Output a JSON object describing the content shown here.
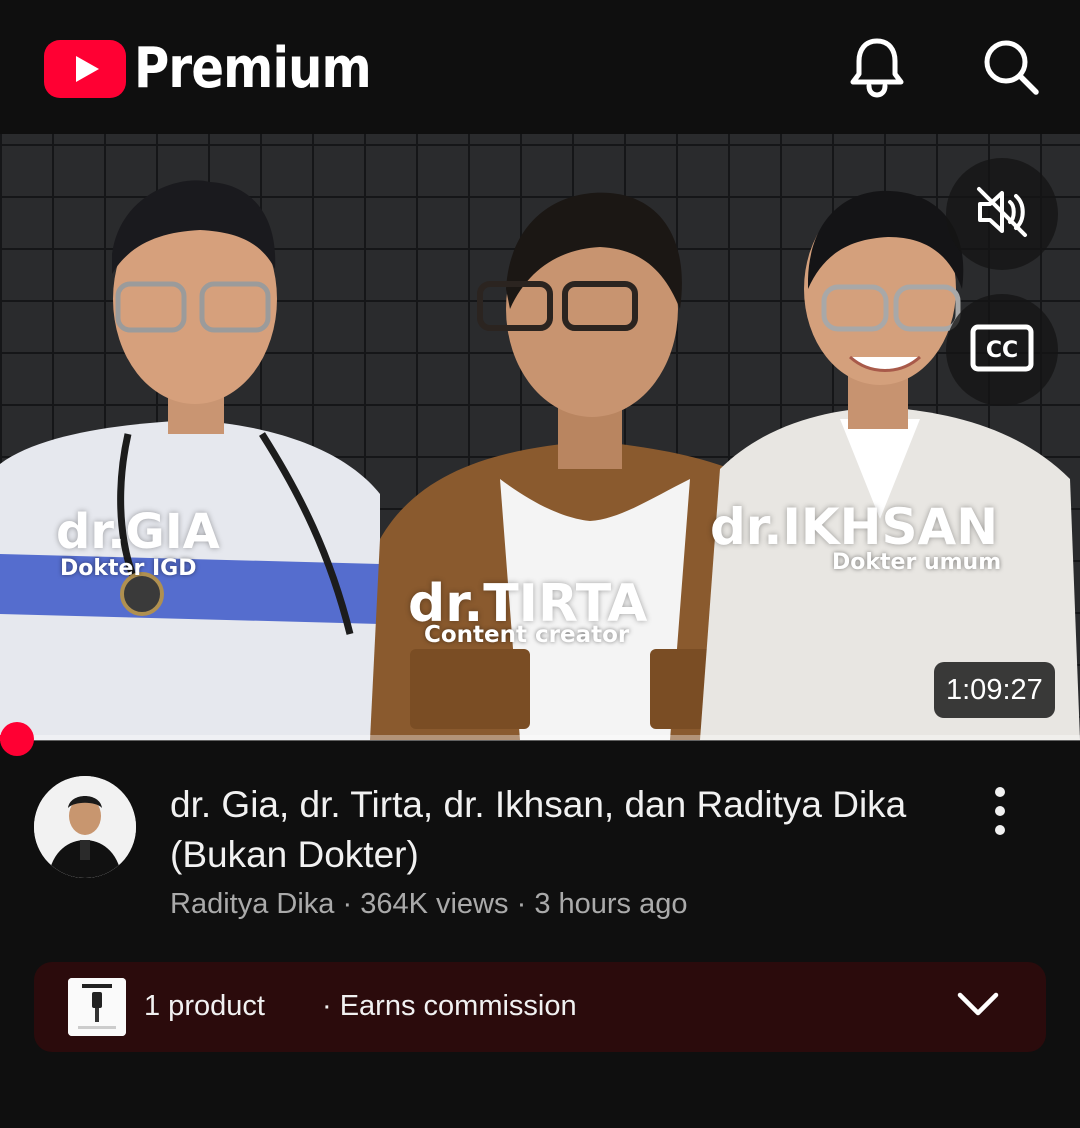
{
  "header": {
    "brand_label": "Premium",
    "logo_icon": "youtube-logo",
    "notifications_icon": "bell-icon",
    "search_icon": "search-icon"
  },
  "video": {
    "people": [
      {
        "name": "dr.GIA",
        "role": "Dokter IGD"
      },
      {
        "name": "dr.TIRTA",
        "role": "Content creator"
      },
      {
        "name": "dr.IKHSAN",
        "role": "Dokter umum"
      }
    ],
    "mute_icon": "volume-muted-icon",
    "captions_icon": "closed-captions-icon",
    "duration": "1:09:27",
    "progress_fraction": 0.015
  },
  "info": {
    "title": "dr. Gia, dr. Tirta, dr. Ikhsan, dan Raditya Dika (Bukan Dokter)",
    "channel": "Raditya Dika",
    "views": "364K views",
    "age": "3 hours ago",
    "separator": "·",
    "more_icon": "more-vertical-icon"
  },
  "products": {
    "count_label": "1 product",
    "commission_label": "· Earns commission",
    "expand_icon": "chevron-down-icon"
  },
  "colors": {
    "accent": "#ff0033",
    "background": "#0f0f0f",
    "product_bar": "#2b0b0c",
    "secondary_text": "#aaaaaa"
  }
}
